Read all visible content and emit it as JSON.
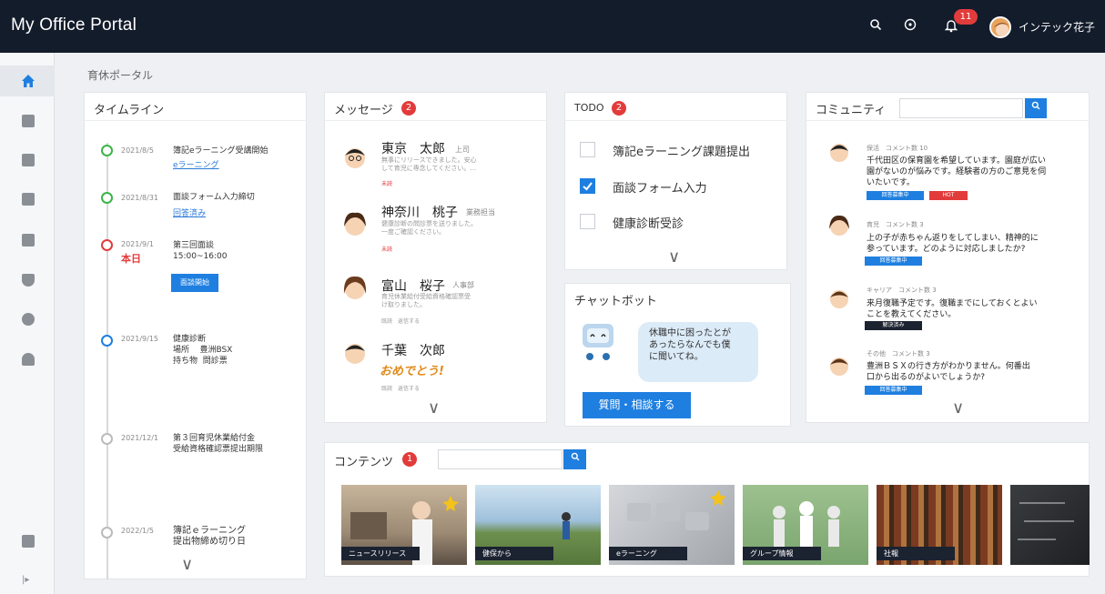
{
  "header": {
    "title": "My Office Portal",
    "notification_count": "11",
    "user_name": "インテック花子"
  },
  "breadcrumb": "育休ポータル",
  "timeline": {
    "title": "タイムライン",
    "items": [
      {
        "date": "2021/8/5",
        "text": "簿記eラーニング受講開始",
        "link": "eラーニング"
      },
      {
        "date": "2021/8/31",
        "text": "面談フォーム入力締切",
        "link": "回答済み"
      },
      {
        "date": "2021/9/1",
        "text": "第三回面談\n15:00~16:00",
        "today": "本日",
        "button": "面談開始"
      },
      {
        "date": "2021/9/15",
        "text": "健康診断\n場所    豊洲BSX\n持ち物  問診票"
      },
      {
        "date": "2021/12/1",
        "text": "第３回育児休業給付金\n受給資格確認票提出期限"
      },
      {
        "date": "2022/1/5",
        "text": "簿記ｅラーニング\n提出物締め切り日"
      }
    ]
  },
  "messages": {
    "title": "メッセージ",
    "badge": "2",
    "items": [
      {
        "name": "東京　太郎",
        "role": "上司",
        "body": "無事にリリースできました。安心\nして育児に専念してください。…",
        "tag": "未読"
      },
      {
        "name": "神奈川　桃子",
        "role": "業務担当",
        "body": "健康診断の問診票を送りました。\n一度ご確認ください。",
        "tag": "未読"
      },
      {
        "name": "富山　桜子",
        "role": "人事部",
        "body": "育児休業給付受給資格確認票受\nけ取りました。",
        "foot": "既読　返信する"
      },
      {
        "name": "千葉　次郎",
        "role": "",
        "body": "",
        "sticker": "おめでとう!",
        "foot": "既読　返信する"
      }
    ]
  },
  "todo": {
    "title": "TODO",
    "badge": "2",
    "items": [
      {
        "label": "簿記eラーニング課題提出",
        "checked": false
      },
      {
        "label": "面談フォーム入力",
        "checked": true
      },
      {
        "label": "健康診断受診",
        "checked": false
      }
    ]
  },
  "chatbot": {
    "title": "チャットボット",
    "bubble": "休職中に困ったとが\nあったらなんでも僕\nに聞いてね。",
    "button": "質問・相談する"
  },
  "community": {
    "title": "コミュニティ",
    "items": [
      {
        "category": "保活",
        "comments": "コメント数 10",
        "body": "千代田区の保育園を希望しています。園庭が広い\n園がないのが悩みです。経験者の方のご意見を伺\nいたいです。",
        "tags": [
          "回答募集中",
          "HOT"
        ]
      },
      {
        "category": "育児",
        "comments": "コメント数 3",
        "body": "上の子が赤ちゃん返りをしてしまい、精神的に\n参っています。どのように対応しましたか?",
        "tags": [
          "回答募集中"
        ]
      },
      {
        "category": "キャリア",
        "comments": "コメント数 3",
        "body": "来月復職予定です。復職までにしておくとよい\nことを教えてください。",
        "tags": [
          "解決済み"
        ]
      },
      {
        "category": "その他",
        "comments": "コメント数 3",
        "body": "豊洲ＢＳＸの行き方がわかりません。何番出\n口から出るのがよいでしょうか?",
        "tags": [
          "回答募集中"
        ]
      }
    ]
  },
  "contents": {
    "title": "コンテンツ",
    "badge": "1",
    "tiles": [
      {
        "label": "ニュースリリース"
      },
      {
        "label": "健保から"
      },
      {
        "label": "eラーニング"
      },
      {
        "label": "グループ情報"
      },
      {
        "label": "社報"
      },
      {
        "label": ""
      }
    ]
  },
  "colors": {
    "accent": "#1e7fe0",
    "alert": "#e23b3b",
    "header": "#131c2b"
  }
}
